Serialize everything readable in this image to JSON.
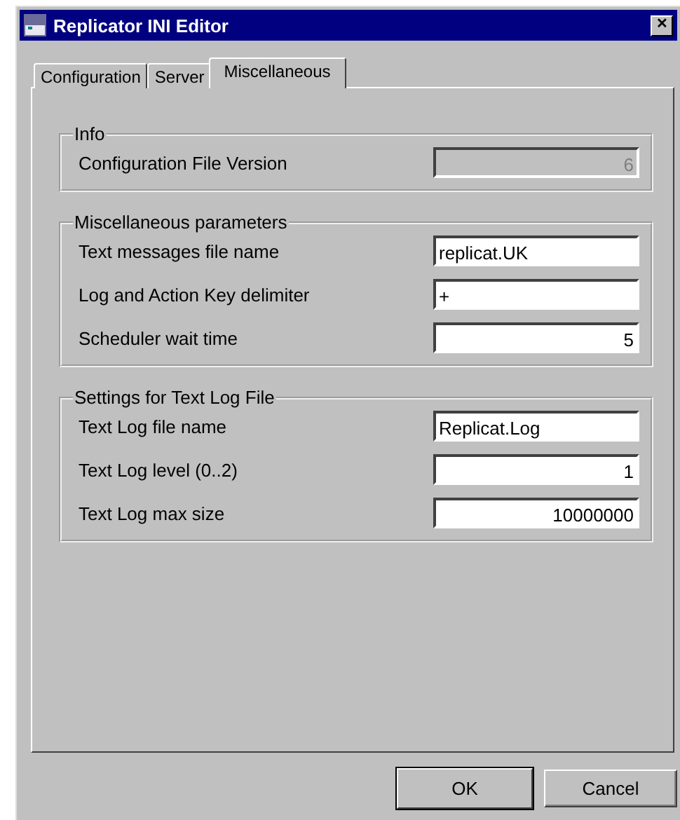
{
  "window": {
    "title": "Replicator INI Editor",
    "close": "✕"
  },
  "tabs": [
    {
      "label": "Configuration",
      "selected": false
    },
    {
      "label": "Server",
      "selected": false
    },
    {
      "label": "Miscellaneous",
      "selected": true
    }
  ],
  "groups": [
    {
      "title": "Info",
      "fields": [
        {
          "label": "Configuration File Version",
          "value": "6",
          "kind": "number",
          "disabled": true
        }
      ]
    },
    {
      "title": "Miscellaneous parameters",
      "fields": [
        {
          "label": "Text messages file name",
          "value": "replicat.UK",
          "kind": "text",
          "disabled": false
        },
        {
          "label": "Log and Action Key delimiter",
          "value": "+",
          "kind": "text",
          "disabled": false
        },
        {
          "label": "Scheduler wait time",
          "value": "5",
          "kind": "number",
          "disabled": false
        }
      ]
    },
    {
      "title": "Settings for Text Log File",
      "fields": [
        {
          "label": "Text Log file name",
          "value": "Replicat.Log",
          "kind": "text",
          "disabled": false
        },
        {
          "label": "Text Log level (0..2)",
          "value": "1",
          "kind": "number",
          "disabled": false
        },
        {
          "label": "Text Log max size",
          "value": "10000000",
          "kind": "number",
          "disabled": false
        }
      ]
    }
  ],
  "buttons": [
    {
      "label": "OK",
      "default": true
    },
    {
      "label": "Cancel",
      "default": false
    }
  ]
}
